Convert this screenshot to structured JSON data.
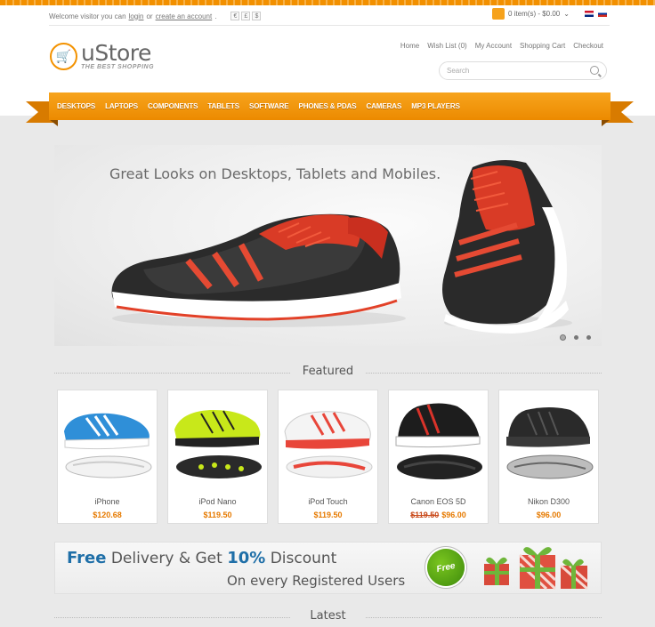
{
  "topbar": {
    "welcome": "Welcome visitor you can",
    "login": "login",
    "or": "or",
    "create": "create an account",
    "tail": ".",
    "currencies": [
      "€",
      "£",
      "$"
    ]
  },
  "cart": {
    "summary": "0 item(s) - $0.00"
  },
  "logo": {
    "title": "uStore",
    "subtitle": "THE BEST SHOPPING"
  },
  "links": [
    "Home",
    "Wish List (0)",
    "My Account",
    "Shopping Cart",
    "Checkout"
  ],
  "search": {
    "placeholder": "Search"
  },
  "menu": [
    "DESKTOPS",
    "LAPTOPS",
    "COMPONENTS",
    "TABLETS",
    "SOFTWARE",
    "PHONES & PDAS",
    "CAMERAS",
    "MP3 PLAYERS"
  ],
  "hero": {
    "text": "Great Looks on Desktops, Tablets and Mobiles."
  },
  "featured": {
    "title": "Featured",
    "products": [
      {
        "name": "iPhone",
        "price": "$120.68",
        "old": ""
      },
      {
        "name": "iPod Nano",
        "price": "$119.50",
        "old": ""
      },
      {
        "name": "iPod Touch",
        "price": "$119.50",
        "old": ""
      },
      {
        "name": "Canon EOS 5D",
        "price": "$96.00",
        "old": "$119.50"
      },
      {
        "name": "Nikon D300",
        "price": "$96.00",
        "old": ""
      }
    ]
  },
  "banner": {
    "free": "Free",
    "delivery": "Delivery & Get",
    "pct": "10%",
    "discount": "Discount",
    "line2": "On every Registered Users",
    "badge": "Free"
  },
  "latest": {
    "title": "Latest"
  },
  "colors": {
    "accent": "#f39200",
    "price": "#e67a00",
    "banner_blue": "#1f6fa8"
  }
}
